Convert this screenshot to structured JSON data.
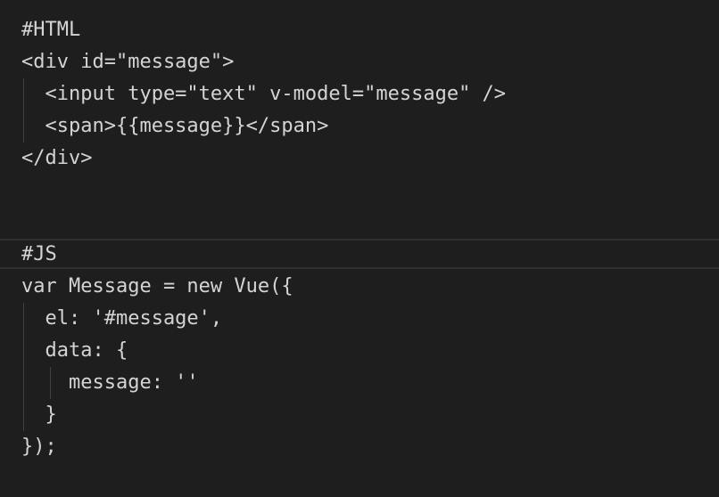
{
  "editor": {
    "theme": {
      "background": "#1e1e1e",
      "text": "#d4d4d4",
      "indent_guide": "#404040",
      "line_highlight_border": "#2f2f2f"
    },
    "lines": [
      "#HTML",
      "<div id=\"message\">",
      "  <input type=\"text\" v-model=\"message\" />",
      "  <span>{{message}}</span>",
      "</div>",
      "",
      "",
      "#JS",
      "var Message = new Vue({",
      "  el: '#message',",
      "  data: {",
      "    message: ''",
      "  }",
      "});"
    ]
  }
}
